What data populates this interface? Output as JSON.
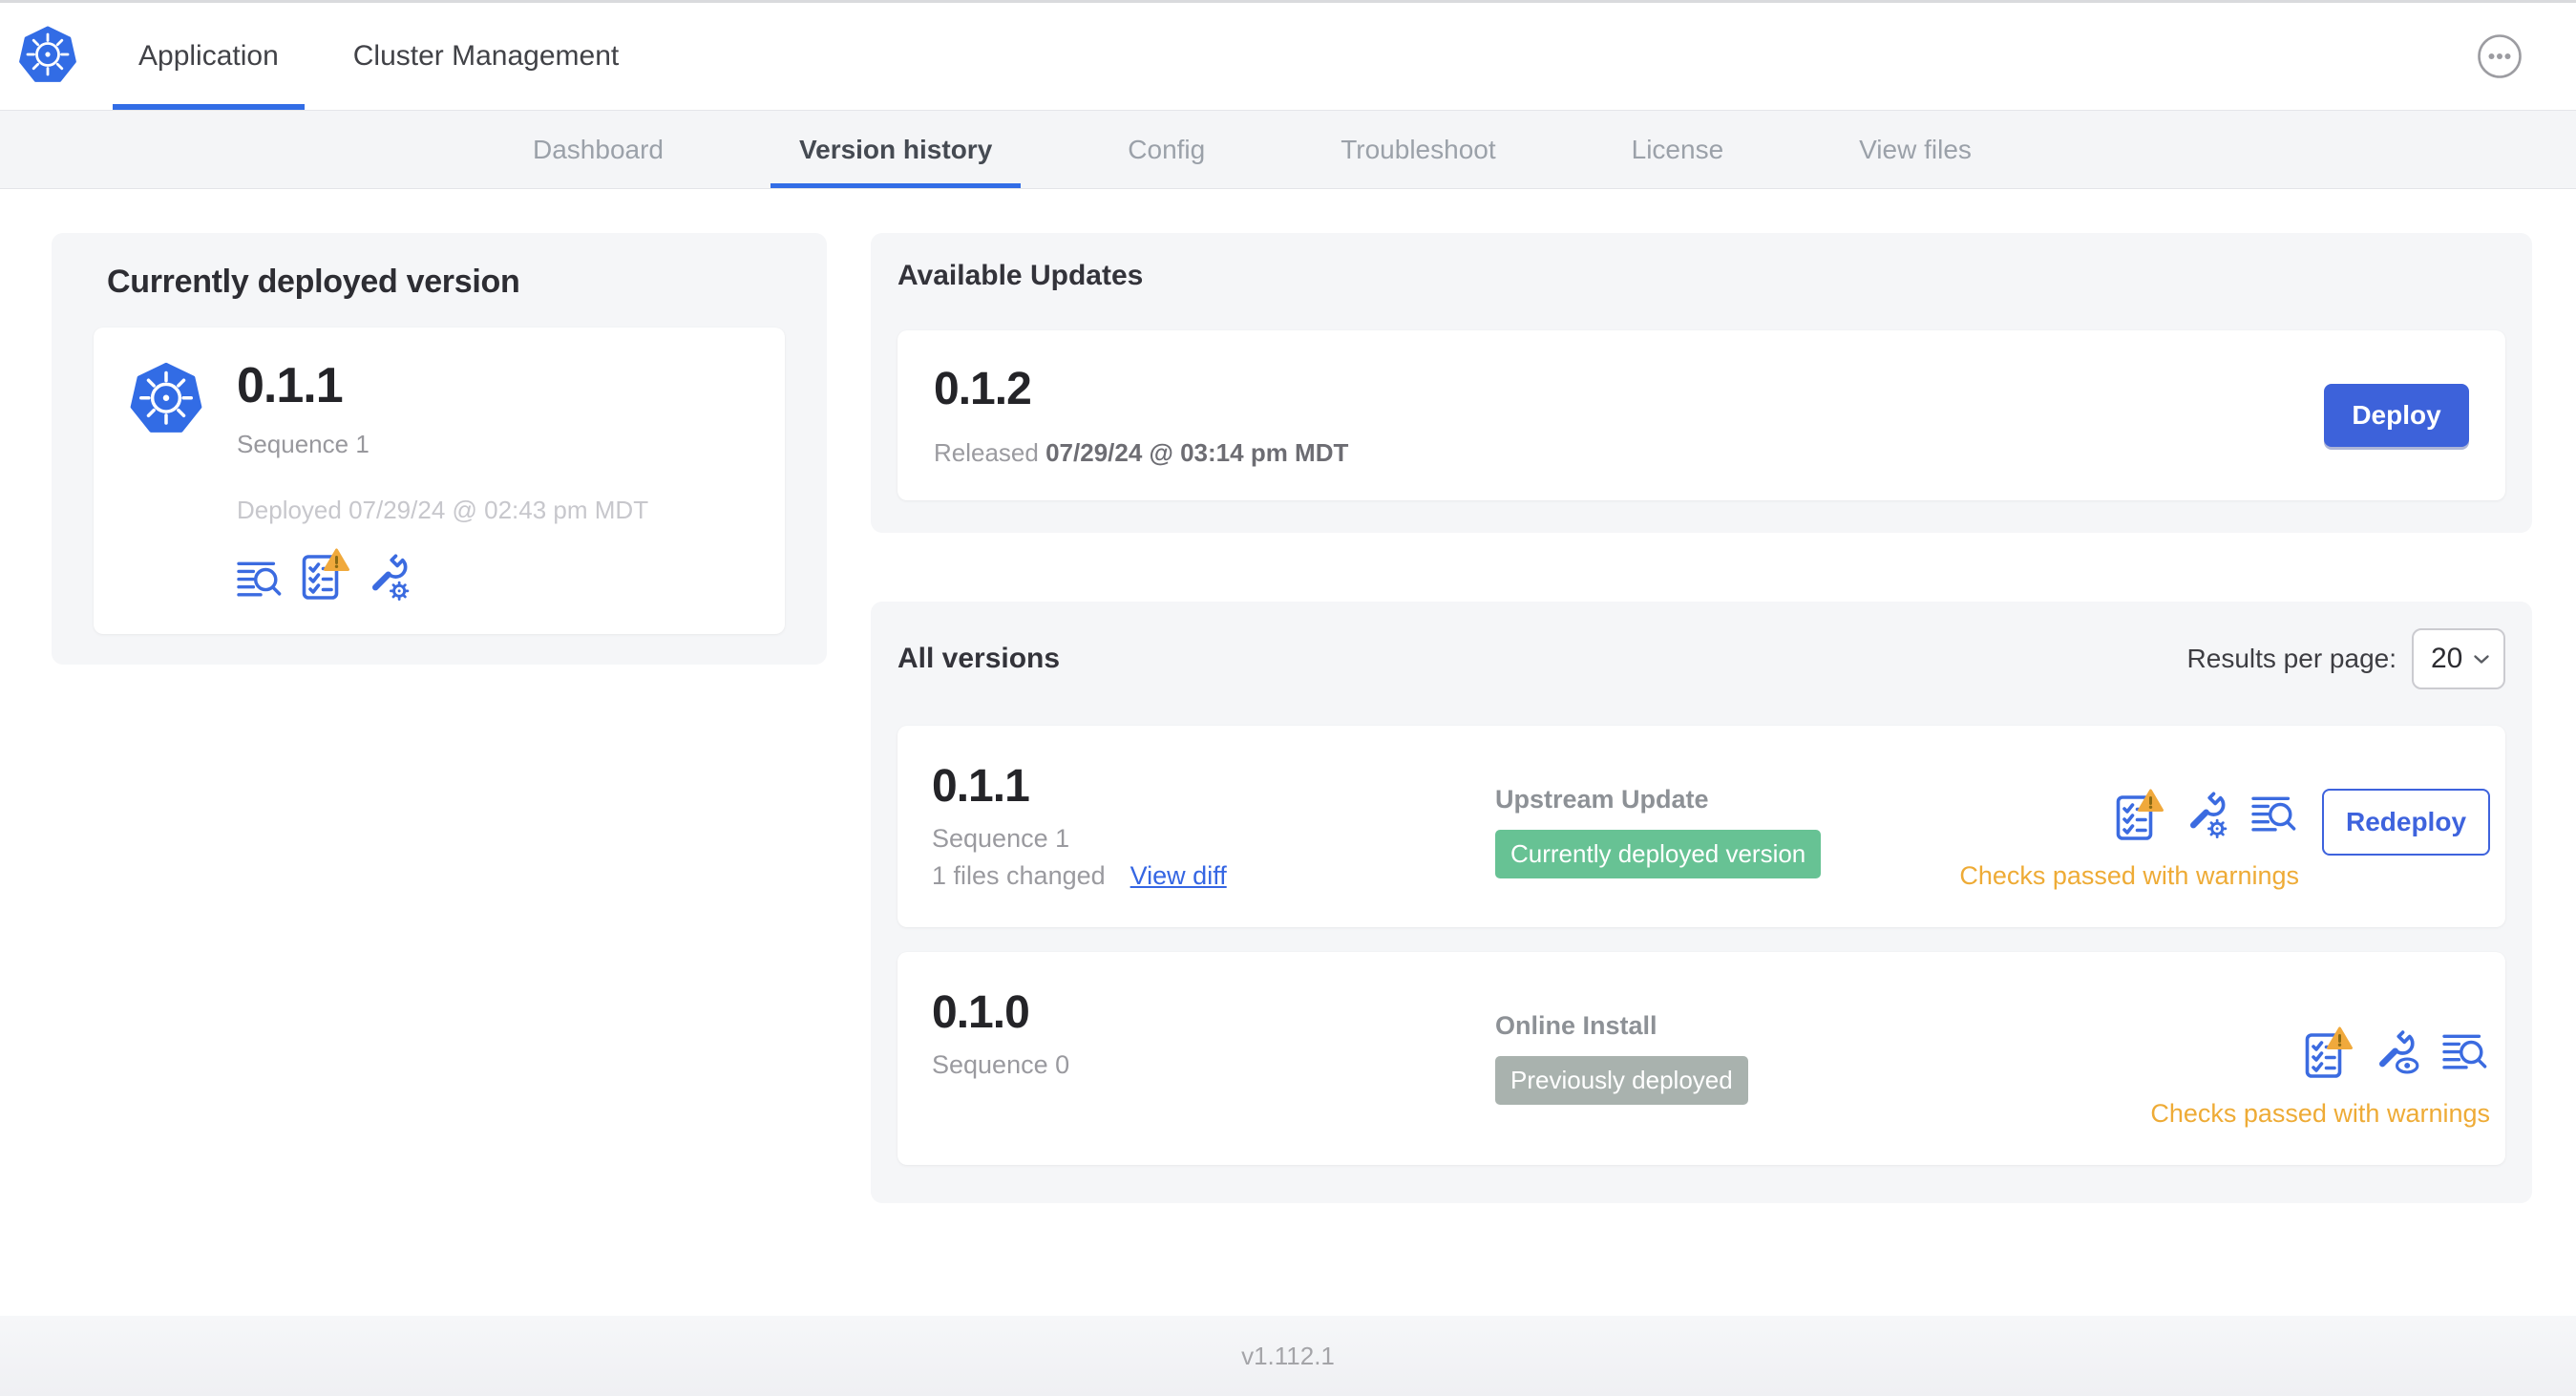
{
  "colors": {
    "primary_blue": "#326DE6",
    "button_blue": "#3D62DA",
    "icon_blue": "#3B6BE0",
    "link_blue": "#3566E3",
    "badge_green": "#67C294",
    "badge_gray": "#A9B2AE",
    "warning_amber": "#EEAB36",
    "panel_gray": "#F5F6F8"
  },
  "topnav": {
    "tabs": [
      {
        "label": "Application"
      },
      {
        "label": "Cluster Management"
      }
    ]
  },
  "subnav": {
    "tabs": [
      {
        "label": "Dashboard"
      },
      {
        "label": "Version history"
      },
      {
        "label": "Config"
      },
      {
        "label": "Troubleshoot"
      },
      {
        "label": "License"
      },
      {
        "label": "View files"
      }
    ],
    "active": "Version history"
  },
  "currently_deployed": {
    "title": "Currently deployed version",
    "version": "0.1.1",
    "sequence": "Sequence 1",
    "deployed": "Deployed 07/29/24 @ 02:43 pm MDT"
  },
  "available_updates": {
    "title": "Available Updates",
    "version": "0.1.2",
    "released_label": "Released",
    "released_value": "07/29/24 @ 03:14 pm MDT",
    "deploy_button": "Deploy"
  },
  "all_versions": {
    "title": "All versions",
    "results_per_page_label": "Results per page:",
    "results_per_page_value": "20",
    "rows": [
      {
        "version": "0.1.1",
        "sequence": "Sequence 1",
        "files_changed": "1 files changed",
        "view_diff_link": "View diff",
        "source": "Upstream Update",
        "badge_label": "Currently deployed version",
        "checks_status": "Checks passed with warnings",
        "action_button": "Redeploy"
      },
      {
        "version": "0.1.0",
        "sequence": "Sequence 0",
        "source": "Online Install",
        "badge_label": "Previously deployed",
        "checks_status": "Checks passed with warnings"
      }
    ]
  },
  "footer": {
    "app_version": "v1.112.1"
  }
}
